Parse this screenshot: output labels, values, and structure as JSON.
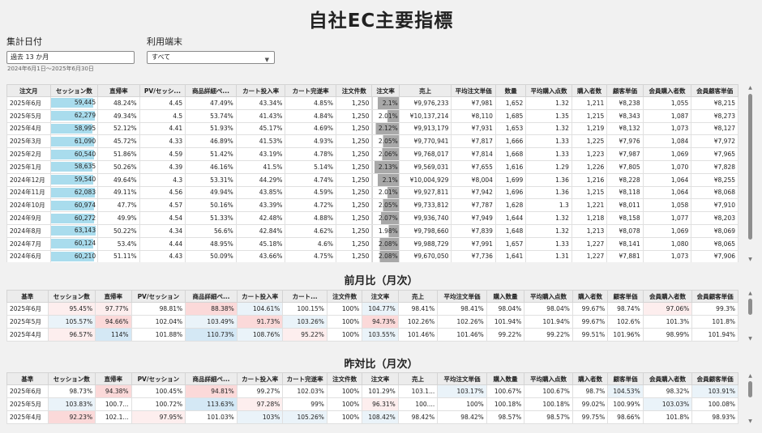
{
  "title": "自社EC主要指標",
  "filters": {
    "date_label": "集計日付",
    "date_value": "過去 13 か月",
    "date_range": "2024年6月1日～2025年6月30日",
    "device_label": "利用端末",
    "device_value": "すべて"
  },
  "sections": {
    "mom_title": "前月比（月次）",
    "yoy_title": "昨対比（月次）"
  },
  "main_table": {
    "headers": [
      "注文月",
      "セッション数",
      "直帰率",
      "PV/セッシ...",
      "商品詳細ペ...",
      "カート投入率",
      "カート完遂率",
      "注文件数",
      "注文率",
      "売上",
      "平均注文単価",
      "数量",
      "平均購入点数",
      "購入者数",
      "顧客単価",
      "会員購入者数",
      "会員顧客単価"
    ],
    "session_max": 63143,
    "rows": [
      [
        "2025年6月",
        "59,445",
        "48.24%",
        "4.45",
        "47.49%",
        "43.34%",
        "4.85%",
        "1,250",
        "2.1%",
        "¥9,976,233",
        "¥7,981",
        "1,652",
        "1.32",
        "1,211",
        "¥8,238",
        "1,055",
        "¥8,215"
      ],
      [
        "2025年5月",
        "62,279",
        "49.34%",
        "4.5",
        "53.74%",
        "41.43%",
        "4.84%",
        "1,250",
        "2.01%",
        "¥10,137,214",
        "¥8,110",
        "1,685",
        "1.35",
        "1,215",
        "¥8,343",
        "1,087",
        "¥8,273"
      ],
      [
        "2025年4月",
        "58,995",
        "52.12%",
        "4.41",
        "51.93%",
        "45.17%",
        "4.69%",
        "1,250",
        "2.12%",
        "¥9,913,179",
        "¥7,931",
        "1,653",
        "1.32",
        "1,219",
        "¥8,132",
        "1,073",
        "¥8,127"
      ],
      [
        "2025年3月",
        "61,090",
        "45.72%",
        "4.33",
        "46.89%",
        "41.53%",
        "4.93%",
        "1,250",
        "2.05%",
        "¥9,770,941",
        "¥7,817",
        "1,666",
        "1.33",
        "1,225",
        "¥7,976",
        "1,084",
        "¥7,972"
      ],
      [
        "2025年2月",
        "60,540",
        "51.86%",
        "4.59",
        "51.42%",
        "43.19%",
        "4.78%",
        "1,250",
        "2.06%",
        "¥9,768,017",
        "¥7,814",
        "1,668",
        "1.33",
        "1,223",
        "¥7,987",
        "1,069",
        "¥7,965"
      ],
      [
        "2025年1月",
        "58,635",
        "50.26%",
        "4.39",
        "46.16%",
        "41.5%",
        "5.14%",
        "1,250",
        "2.13%",
        "¥9,569,031",
        "¥7,655",
        "1,616",
        "1.29",
        "1,226",
        "¥7,805",
        "1,070",
        "¥7,828"
      ],
      [
        "2024年12月",
        "59,540",
        "49.64%",
        "4.3",
        "53.31%",
        "44.29%",
        "4.74%",
        "1,250",
        "2.1%",
        "¥10,004,929",
        "¥8,004",
        "1,699",
        "1.36",
        "1,216",
        "¥8,228",
        "1,064",
        "¥8,255"
      ],
      [
        "2024年11月",
        "62,083",
        "49.11%",
        "4.56",
        "49.94%",
        "43.85%",
        "4.59%",
        "1,250",
        "2.01%",
        "¥9,927,811",
        "¥7,942",
        "1,696",
        "1.36",
        "1,215",
        "¥8,118",
        "1,064",
        "¥8,068"
      ],
      [
        "2024年10月",
        "60,974",
        "47.7%",
        "4.57",
        "50.16%",
        "43.39%",
        "4.72%",
        "1,250",
        "2.05%",
        "¥9,733,812",
        "¥7,787",
        "1,628",
        "1.3",
        "1,221",
        "¥8,011",
        "1,058",
        "¥7,910"
      ],
      [
        "2024年9月",
        "60,272",
        "49.9%",
        "4.54",
        "51.33%",
        "42.48%",
        "4.88%",
        "1,250",
        "2.07%",
        "¥9,936,740",
        "¥7,949",
        "1,644",
        "1.32",
        "1,218",
        "¥8,158",
        "1,077",
        "¥8,203"
      ],
      [
        "2024年8月",
        "63,143",
        "50.22%",
        "4.34",
        "56.6%",
        "42.84%",
        "4.62%",
        "1,250",
        "1.98%",
        "¥9,798,660",
        "¥7,839",
        "1,648",
        "1.32",
        "1,213",
        "¥8,078",
        "1,069",
        "¥8,069"
      ],
      [
        "2024年7月",
        "60,124",
        "53.4%",
        "4.44",
        "48.95%",
        "45.18%",
        "4.6%",
        "1,250",
        "2.08%",
        "¥9,988,729",
        "¥7,991",
        "1,657",
        "1.33",
        "1,227",
        "¥8,141",
        "1,080",
        "¥8,065"
      ],
      [
        "2024年6月",
        "60,210",
        "51.11%",
        "4.43",
        "50.09%",
        "43.66%",
        "4.75%",
        "1,250",
        "2.08%",
        "¥9,670,050",
        "¥7,736",
        "1,641",
        "1.31",
        "1,227",
        "¥7,881",
        "1,073",
        "¥7,906"
      ]
    ]
  },
  "mom_table": {
    "headers": [
      "基準",
      "セッション数",
      "直帰率",
      "PV/セッション",
      "商品詳細ペ...",
      "カート投入率",
      "カート...",
      "注文件数",
      "注文率",
      "売上",
      "平均注文単価",
      "購入数量",
      "平均購入点数",
      "購入者数",
      "顧客単価",
      "会員購入者数",
      "会員顧客単価"
    ],
    "rows": [
      [
        "2025年6月",
        "95.45%",
        "97.77%",
        "98.81%",
        "88.38%",
        "104.61%",
        "100.15%",
        "100%",
        "104.77%",
        "98.41%",
        "98.41%",
        "98.04%",
        "98.04%",
        "99.67%",
        "98.74%",
        "97.06%",
        "99.3%"
      ],
      [
        "2025年5月",
        "105.57%",
        "94.66%",
        "102.04%",
        "103.49%",
        "91.73%",
        "103.26%",
        "100%",
        "94.73%",
        "102.26%",
        "102.26%",
        "101.94%",
        "101.94%",
        "99.67%",
        "102.6%",
        "101.3%",
        "101.8%"
      ],
      [
        "2025年4月",
        "96.57%",
        "114%",
        "101.88%",
        "110.73%",
        "108.76%",
        "95.22%",
        "100%",
        "103.55%",
        "101.46%",
        "101.46%",
        "99.22%",
        "99.22%",
        "99.51%",
        "101.96%",
        "98.99%",
        "101.94%"
      ]
    ]
  },
  "yoy_table": {
    "headers": [
      "基準",
      "セッション数",
      "直帰率",
      "PV/セッション",
      "商品詳細ペ...",
      "カート投入率",
      "カート完遂率",
      "注文件数",
      "注文率",
      "売上",
      "平均注文単価",
      "購入数量",
      "平均購入点数",
      "購入者数",
      "顧客単価",
      "会員購入者数",
      "会員顧客単価"
    ],
    "rows": [
      [
        "2025年6月",
        "98.73%",
        "94.38%",
        "100.45%",
        "94.81%",
        "99.27%",
        "102.03%",
        "100%",
        "101.29%",
        "103.1...",
        "103.17%",
        "100.67%",
        "100.67%",
        "98.7%",
        "104.53%",
        "98.32%",
        "103.91%"
      ],
      [
        "2025年5月",
        "103.83%",
        "100.7...",
        "100.72%",
        "113.63%",
        "97.28%",
        "99%",
        "100%",
        "96.31%",
        "100....",
        "100%",
        "100.18%",
        "100.18%",
        "99.02%",
        "100.99%",
        "103.03%",
        "100.08%"
      ],
      [
        "2025年4月",
        "92.23%",
        "102.1...",
        "97.95%",
        "101.03%",
        "103%",
        "105.26%",
        "100%",
        "108.42%",
        "98.42%",
        "98.42%",
        "98.57%",
        "98.57%",
        "99.75%",
        "98.66%",
        "101.8%",
        "98.93%"
      ]
    ]
  },
  "colors": {
    "session_bar": "#a9dced",
    "order_rate_fill": "#a8a8a8",
    "pos_strong": "#fbd9d9",
    "pos_light": "#fdeeee",
    "neg_strong": "#d4e8f5",
    "neg_light": "#eaf3f9"
  }
}
